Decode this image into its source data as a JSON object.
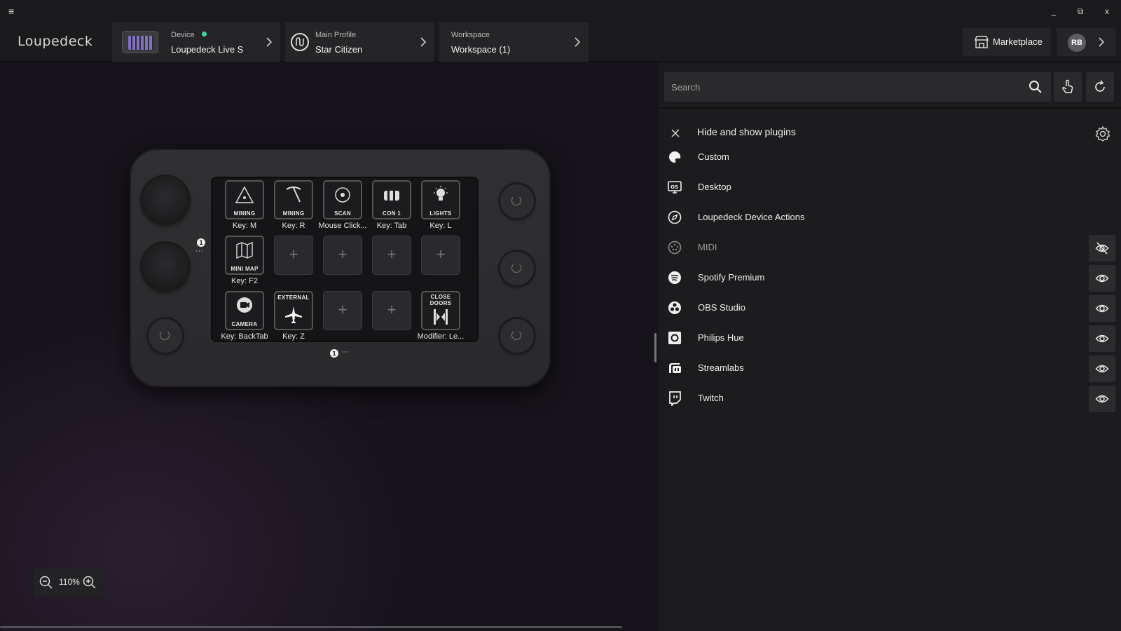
{
  "window": {
    "menu_glyph": "≡",
    "minimize": "_",
    "restore": "⧉",
    "close": "x"
  },
  "header": {
    "logo": "Loupedeck",
    "device": {
      "caption": "Device",
      "value": "Loupedeck Live S",
      "status_color": "#3fd6a0"
    },
    "profile": {
      "caption": "Main Profile",
      "value": "Star Citizen"
    },
    "workspace": {
      "caption": "Workspace",
      "value": "Workspace (1)"
    },
    "marketplace_label": "Marketplace",
    "user_initials": "RB"
  },
  "device_view": {
    "keys": [
      {
        "row": 0,
        "col": 0,
        "icon_text": "MINING",
        "label": "Key: M"
      },
      {
        "row": 0,
        "col": 1,
        "icon_text": "MINING",
        "label": "Key: R"
      },
      {
        "row": 0,
        "col": 2,
        "icon_text": "SCAN",
        "label": "Mouse Click..."
      },
      {
        "row": 0,
        "col": 3,
        "icon_text": "CON 1",
        "label": "Key: Tab"
      },
      {
        "row": 0,
        "col": 4,
        "icon_text": "LIGHTS",
        "label": "Key: L"
      },
      {
        "row": 1,
        "col": 0,
        "icon_text": "MINI MAP",
        "label": "Key: F2"
      },
      {
        "row": 2,
        "col": 0,
        "icon_text": "CAMERA",
        "label": "Key: BackTab"
      },
      {
        "row": 2,
        "col": 1,
        "icon_text": "EXTERNAL",
        "label": "Key: Z"
      },
      {
        "row": 2,
        "col": 4,
        "icon_text": "CLOSE DOORS",
        "label": "Modifier: Le..."
      }
    ],
    "empty_key_glyph": "+",
    "page_number_side": "1",
    "page_number_bottom": "1",
    "more_glyph": "···",
    "zoom_level": "110%"
  },
  "plugins_panel": {
    "search_placeholder": "Search",
    "title": "Hide and show plugins",
    "plugins": [
      {
        "name": "Custom",
        "icon": "palette-icon",
        "toggle": false
      },
      {
        "name": "Desktop",
        "icon": "desktop-os-icon",
        "toggle": false
      },
      {
        "name": "Loupedeck Device Actions",
        "icon": "compass-icon",
        "toggle": false
      },
      {
        "name": "MIDI",
        "icon": "midi-icon",
        "toggle": true,
        "visible": false
      },
      {
        "name": "Spotify Premium",
        "icon": "spotify-icon",
        "toggle": true,
        "visible": true
      },
      {
        "name": "OBS Studio",
        "icon": "obs-icon",
        "toggle": true,
        "visible": true
      },
      {
        "name": "Philips Hue",
        "icon": "hue-icon",
        "toggle": true,
        "visible": true
      },
      {
        "name": "Streamlabs",
        "icon": "streamlabs-icon",
        "toggle": true,
        "visible": true
      },
      {
        "name": "Twitch",
        "icon": "twitch-icon",
        "toggle": true,
        "visible": true
      }
    ]
  }
}
